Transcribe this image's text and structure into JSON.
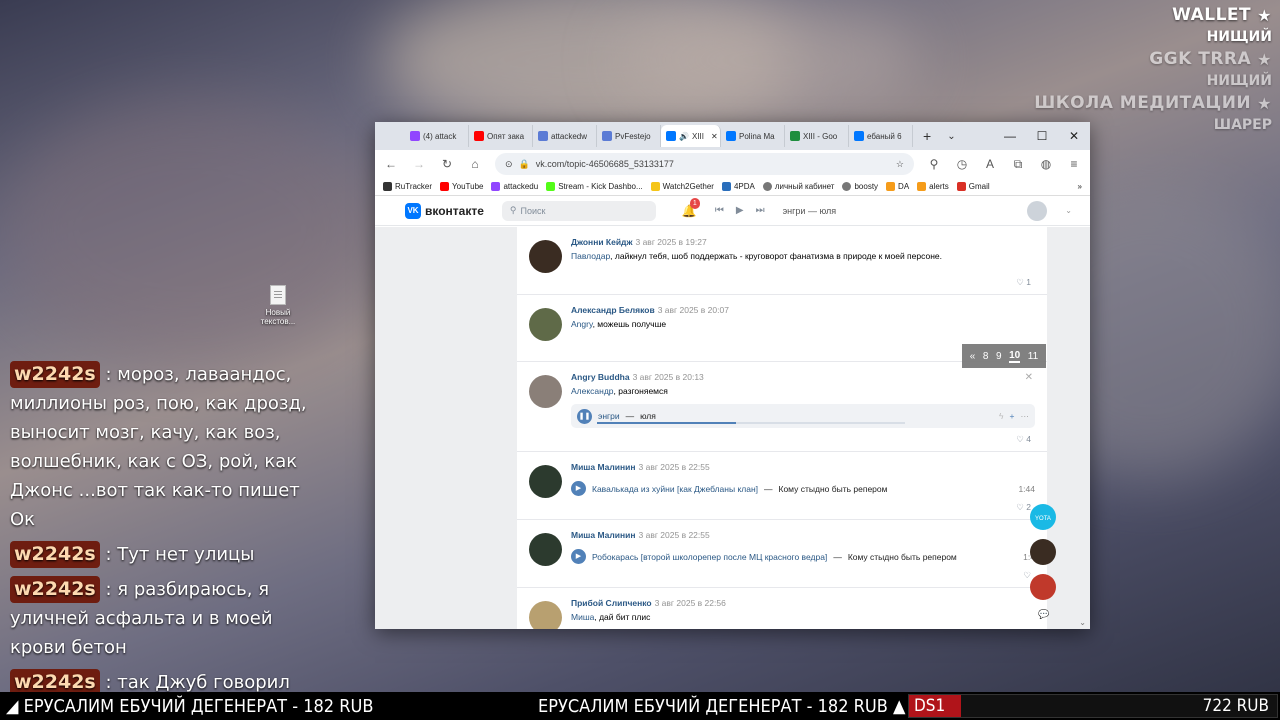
{
  "overlay": {
    "wallet_title": "WALLET",
    "wallet_value": "НИЩИЙ",
    "ggk_title": "GGK TRRA",
    "ggk_value": "НИЩИЙ",
    "meditation_title": "ШКОЛА МЕДИТАЦИИ",
    "meditation_value": "ШАРЕР",
    "star_icon": "★"
  },
  "desktop": {
    "file_label": "Новый текстов..."
  },
  "chat": [
    {
      "nick": "w2242s",
      "text": ": мороз, лаваандос, миллионы роз, пою, как дрозд, выносит мозг, качу, как воз, волшебник, как с ОЗ, рой, как Джонс ...вот так как-то пишет Ок"
    },
    {
      "nick": "w2242s",
      "text": ": Тут нет улицы"
    },
    {
      "nick": "w2242s",
      "text": ": я разбираюсь, я уличней асфальта и в моей крови бетон"
    },
    {
      "nick": "w2242s",
      "text": ": так Джуб говорил"
    }
  ],
  "ticker": {
    "left_text": "◢ ЕРУСАЛИМ ЕБУЧИЙ ДЕГЕНЕРАТ - 182 RUB",
    "center_text": "ЕРУСАЛИМ ЕБУЧИЙ ДЕГЕНЕРАТ - 182 RUB ▲",
    "goal_label": "DS1",
    "goal_amount": "722 RUB",
    "goal_progress_fraction": 0.14
  },
  "browser": {
    "tabs": [
      {
        "label": "(4) attack",
        "color": "#9146ff"
      },
      {
        "label": "Опят зака",
        "color": "#ff0000"
      },
      {
        "label": "attackedw",
        "color": "#5b7bd5"
      },
      {
        "label": "PvFestejo",
        "color": "#5b7bd5"
      },
      {
        "label": "XIII",
        "color": "#0077ff"
      },
      {
        "label": "Polina Ma",
        "color": "#0077ff"
      },
      {
        "label": "XIII - Goo",
        "color": "#1e8e3e"
      },
      {
        "label": "ебаный 6",
        "color": "#0077ff"
      }
    ],
    "new_tab": "+",
    "tab_list": "⌄",
    "win_min": "—",
    "win_max": "☐",
    "win_close": "✕",
    "url": "vk.com/topic-46506685_53133177",
    "bookmarks": [
      {
        "label": "RuTracker",
        "color": "#333"
      },
      {
        "label": "YouTube",
        "color": "#ff0000"
      },
      {
        "label": "attackedu",
        "color": "#9146ff"
      },
      {
        "label": "Stream - Kick Dashbo...",
        "color": "#53fc18"
      },
      {
        "label": "Watch2Gether",
        "color": "#f5c518"
      },
      {
        "label": "4PDA",
        "color": "#2a6ebb"
      },
      {
        "label": "личный кабинет",
        "color": "#777"
      },
      {
        "label": "boosty",
        "color": "#777"
      },
      {
        "label": "DA",
        "color": "#f59c1a"
      },
      {
        "label": "alerts",
        "color": "#f59c1a"
      },
      {
        "label": "Gmail",
        "color": "#d93025"
      }
    ]
  },
  "vk": {
    "logo_text": "вконтакте",
    "search_placeholder": "Поиск",
    "notifications_count": "1",
    "now_playing": "энгри — юля",
    "pager": [
      "«",
      "8",
      "9",
      "10",
      "11"
    ],
    "posts": [
      {
        "name": "Джонни Кейдж",
        "date": "3 авг 2025 в 19:27",
        "reply_to": "Павлодар",
        "text": ", лайкнул тебя, шоб поддержать - круговорот фанатизма в природе к моей персоне.",
        "likes": "1",
        "avatar_color": "#3a2c22"
      },
      {
        "name": "Александр Беляков",
        "date": "3 авг 2025 в 20:07",
        "reply_to": "Angry",
        "text": ", можешь получше",
        "likes": "",
        "avatar_color": "#5f6a48"
      },
      {
        "name": "Angry Buddha",
        "date": "3 авг 2025 в 20:13",
        "reply_to": "Александр",
        "text": ", разгоняемся",
        "likes": "4",
        "avatar_color": "#8a7f78",
        "audio": {
          "artist": "энгри",
          "sep": "—",
          "title": "юля"
        }
      },
      {
        "name": "Миша Малинин",
        "date": "3 авг 2025 в 22:55",
        "audio_artist": "Кавалькада из хуйни [как Джебланы клан]",
        "audio_sep": "—",
        "audio_title": "Кому стыдно быть репером",
        "duration": "1:44",
        "likes": "2",
        "avatar_color": "#2c3a2e"
      },
      {
        "name": "Миша Малинин",
        "date": "3 авг 2025 в 22:55",
        "audio_artist": "Робокарась [второй школорепер после МЦ красного ведра]",
        "audio_sep": "—",
        "audio_title": "Кому стыдно быть репером",
        "duration": "1:4",
        "likes": "",
        "avatar_color": "#2c3a2e"
      },
      {
        "name": "Прибой Слипченко",
        "date": "3 авг 2025 в 22:56",
        "reply_to": "Миша",
        "text": ", дай бит плис",
        "likes": "",
        "avatar_color": "#b8a070"
      }
    ],
    "yota_label": "YOTA"
  }
}
